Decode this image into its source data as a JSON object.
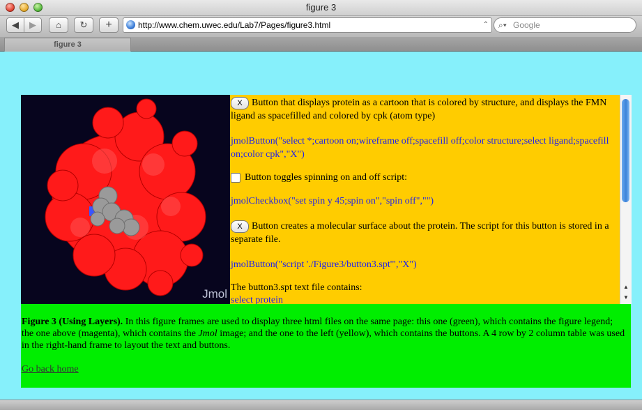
{
  "window": {
    "title": "figure 3"
  },
  "toolbar": {
    "back_icon": "back-arrow-icon",
    "forward_icon": "forward-arrow-icon",
    "home_icon": "home-icon",
    "reload_icon": "reload-icon",
    "add_icon": "plus-icon",
    "url": "http://www.chem.uwec.edu/Lab7/Pages/figure3.html",
    "search_placeholder": "Google"
  },
  "tabs": [
    {
      "label": "figure 3"
    }
  ],
  "viewer": {
    "watermark": "Jmol",
    "background": "#07051e",
    "protein_color": "#ff1a1a",
    "ligand_color": "#9a9a9a"
  },
  "controls": [
    {
      "type": "button",
      "button_label": "X",
      "description": "Button that displays protein as a cartoon that is colored by structure, and displays the FMN ligand as spacefilled and colored by cpk (atom type)",
      "code": "jmolButton(\"select *;cartoon on;wireframe off;spacefill off;color structure;select ligand;spacefill on;color cpk\",\"X\")"
    },
    {
      "type": "checkbox",
      "description": "Button toggles spinning on and off script:",
      "code": "jmolCheckbox(\"set spin y 45;spin on\",\"spin off\",\"\")"
    },
    {
      "type": "button",
      "button_label": "X",
      "description": "Button creates a molecular surface about the protein. The script for this button is stored in a separate file.",
      "code": "jmolButton(\"script './Figure3/button3.spt'\",\"X\")"
    }
  ],
  "file_note": {
    "text": "The button3.spt text file contains:",
    "code": "select protein"
  },
  "legend": {
    "title": "Figure 3 (Using Layers).",
    "text_before_jmol": " In this figure frames are used to display three html files on the same page: this one (green), which contains the figure legend; the one above (magenta), which contains the ",
    "jmol": "Jmol",
    "text_after_jmol": " image; and the one to the left (yellow), which contains the buttons. A 4 row by 2 column table was used in the right-hand frame to layout the text and buttons.",
    "home_link": "Go back home"
  },
  "colors": {
    "page_bg": "#86f0fb",
    "right_frame": "#ffcc00",
    "bottom_frame": "#00ee00",
    "code_text": "#2323e8"
  }
}
